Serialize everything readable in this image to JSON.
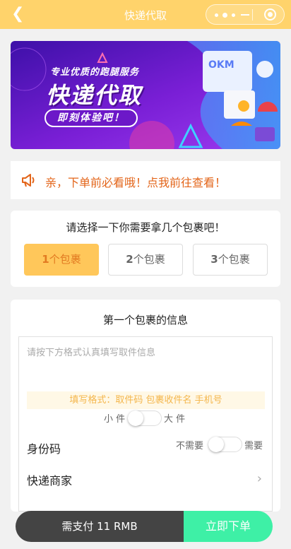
{
  "nav": {
    "title": "快递代取",
    "back_icon": "chevron-left-icon"
  },
  "banner": {
    "subtitle": "专业优质的跑腿服务",
    "title": "快递代取",
    "cta": "即刻体验吧！"
  },
  "notice": {
    "text": "亲，下单前必看哦！点我前往查看！",
    "icon": "megaphone-icon"
  },
  "package_picker": {
    "title": "请选择一下你需要拿几个包裹吧！",
    "options": [
      {
        "num": "1",
        "unit": "个包裹",
        "selected": true
      },
      {
        "num": "2",
        "unit": "个包裹",
        "selected": false
      },
      {
        "num": "3",
        "unit": "个包裹",
        "selected": false
      }
    ]
  },
  "package_info": {
    "title": "第一个包裹的信息",
    "placeholder": "请按下方格式认真填写取件信息",
    "format_hint": "填写格式：取件码 包裹收件名 手机号",
    "size_small": "小 件",
    "size_large": "大 件",
    "id_label": "身份码",
    "id_no": "不需要",
    "id_yes": "需要",
    "courier_label": "快递商家"
  },
  "pay": {
    "amount_text": "需支付 11 RMB",
    "submit_label": "立即下单"
  },
  "colors": {
    "nav": "#ffd36b",
    "accent": "#ffc75a",
    "notice": "#e3651a",
    "submit": "#3ef0a6"
  }
}
